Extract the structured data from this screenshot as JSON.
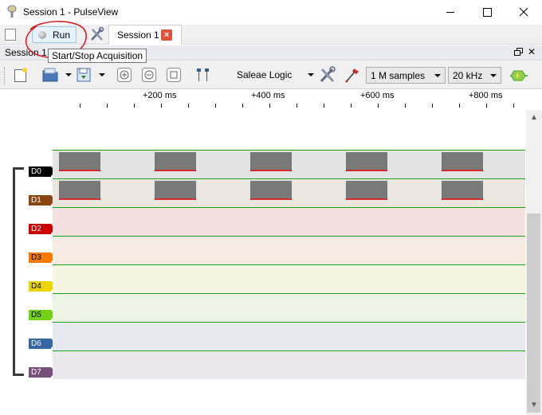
{
  "window": {
    "title": "Session 1 - PulseView"
  },
  "toolbar": {
    "run_label": "Run",
    "session_tab_label": "Session 1",
    "tab_close_glyph": "×"
  },
  "dock": {
    "title": "Session 1",
    "close_glyph": "✕"
  },
  "tooltip": {
    "text": "Start/Stop Acquisition"
  },
  "device_toolbar": {
    "device": "Saleae Logic",
    "samples": "1 M samples",
    "rate": "20 kHz"
  },
  "ruler": {
    "labels": [
      "+200 ms",
      "+400 ms",
      "+600 ms",
      "+800 ms"
    ]
  },
  "channels": [
    {
      "label": "D0",
      "color": "#000000",
      "text_light": true
    },
    {
      "label": "D1",
      "color": "#8b4513",
      "text_light": true
    },
    {
      "label": "D2",
      "color": "#cc0000",
      "text_light": true
    },
    {
      "label": "D3",
      "color": "#f57900",
      "text_light": false
    },
    {
      "label": "D4",
      "color": "#edd400",
      "text_light": false
    },
    {
      "label": "D5",
      "color": "#73d216",
      "text_light": false
    },
    {
      "label": "D6",
      "color": "#3465a4",
      "text_light": true
    },
    {
      "label": "D7",
      "color": "#75507b",
      "text_light": true
    }
  ],
  "colors": {
    "accent_annotation": "#d42222",
    "trace_high": "#1aa31a",
    "trace_low": "#d42a2a"
  },
  "icons": {
    "app": "pulseview-probe-icon",
    "new_session": "new-session-icon",
    "settings": "tools-icon",
    "open": "open-folder-icon",
    "save": "save-icon",
    "zoom_in": "zoom-in-icon",
    "zoom_out": "zoom-out-icon",
    "zoom_fit": "zoom-fit-icon",
    "cursors": "cursor-pair-icon",
    "device_config": "device-config-icon",
    "probe": "probe-icon",
    "decoder": "protocol-decoder-icon"
  }
}
